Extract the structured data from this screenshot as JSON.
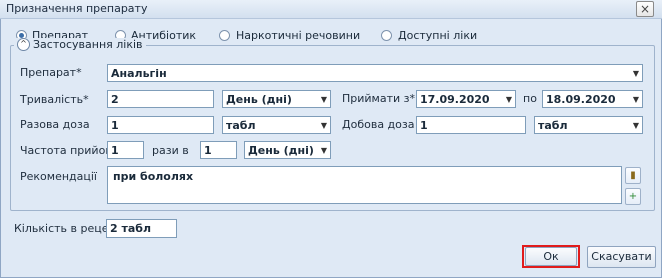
{
  "window": {
    "title": "Призначення препарату",
    "close_glyph": "×"
  },
  "type_options": [
    {
      "label": "Препарат",
      "selected": true
    },
    {
      "label": "Антибіотик",
      "selected": false
    },
    {
      "label": "Наркотичні речовини",
      "selected": false
    },
    {
      "label": "Доступні ліки",
      "selected": false
    }
  ],
  "group": {
    "title": "Застосування ліків",
    "toggle_glyph": "^"
  },
  "form": {
    "drug_label": "Препарат*",
    "drug_value": "Анальгін",
    "duration_label": "Тривалість*",
    "duration_value": "2",
    "duration_unit": "День (дні)",
    "take_from_label": "Приймати з*",
    "take_from_value": "17.09.2020",
    "to_label": "по",
    "to_value": "18.09.2020",
    "single_dose_label": "Разова доза",
    "single_dose_value": "1",
    "single_dose_unit": "табл",
    "daily_dose_label": "Добова доза",
    "daily_dose_value": "1",
    "daily_dose_unit": "табл",
    "frequency_label": "Частота прийому",
    "frequency_value": "1",
    "times_per_label": "рази в",
    "times_per_value": "1",
    "times_per_unit": "День (дні)",
    "recommendations_label": "Рекомендації",
    "recommendations_value": "при бололях"
  },
  "recipe": {
    "label": "Кількість в рецепт",
    "value": "2 табл"
  },
  "buttons": {
    "ok": "Ок",
    "cancel": "Скасувати"
  },
  "colors": {
    "dialog_bg": "#dfe9f5",
    "highlight": "#e11b1b",
    "field_border": "#7f9db9"
  },
  "icons": {
    "dropdown": "▼"
  }
}
